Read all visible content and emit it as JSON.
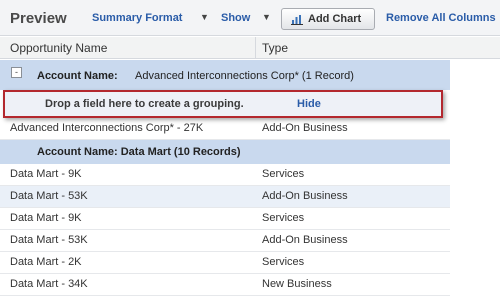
{
  "toolbar": {
    "title": "Preview",
    "summary_format_label": "Summary Format",
    "show_label": "Show",
    "add_chart_label": "Add Chart",
    "remove_all_columns_label": "Remove All Columns"
  },
  "table": {
    "columns": [
      "Opportunity Name",
      "Type"
    ]
  },
  "groups": [
    {
      "label": "Account Name:",
      "value": "Advanced Interconnections Corp* (1 Record)",
      "toggle": "-"
    },
    {
      "label": "Account Name: Data Mart (10 Records)"
    }
  ],
  "dropzone": {
    "text": "Drop a field here to create a grouping.",
    "hide_label": "Hide"
  },
  "rows": [
    {
      "name": "Advanced Interconnections Corp* - 27K",
      "type": "Add-On Business"
    },
    {
      "name": "Data Mart - 9K",
      "type": "Services"
    },
    {
      "name": "Data Mart - 53K",
      "type": "Add-On Business"
    },
    {
      "name": "Data Mart - 9K",
      "type": "Services"
    },
    {
      "name": "Data Mart - 53K",
      "type": "Add-On Business"
    },
    {
      "name": "Data Mart - 2K",
      "type": "Services"
    },
    {
      "name": "Data Mart - 34K",
      "type": "New Business"
    }
  ],
  "colors": {
    "group_header_bg": "#c9d9ee",
    "link": "#2a5ca8",
    "highlight_border": "#b3282e",
    "alt_row_bg": "#eaf0f8"
  },
  "icons": {
    "add_chart": "bar-chart-icon",
    "summary_format_caret": "chevron-down-icon",
    "show_caret": "chevron-down-icon",
    "group_toggle": "collapse-icon"
  }
}
